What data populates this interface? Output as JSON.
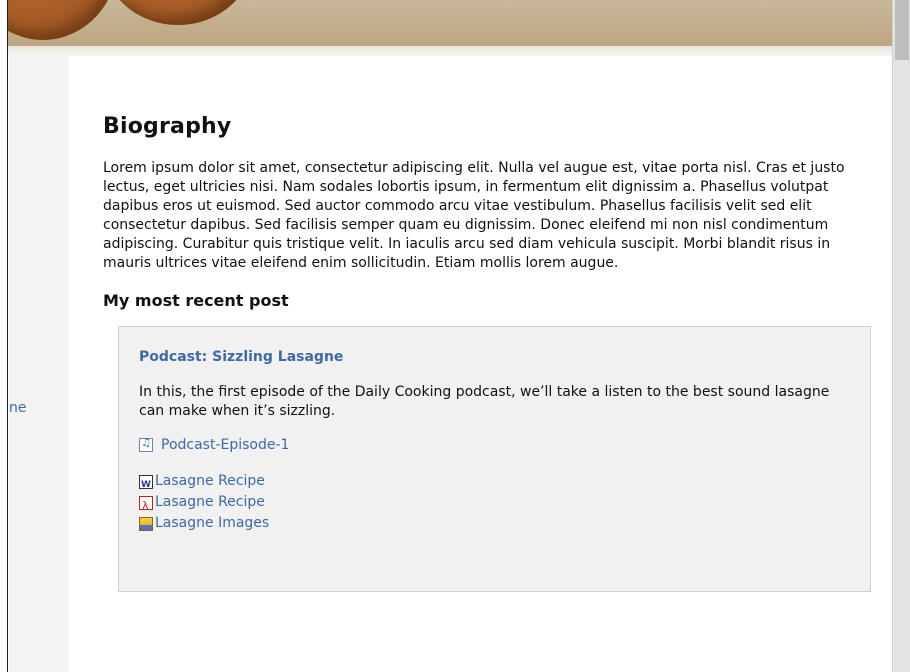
{
  "sidebar": {
    "partial_link": "ne"
  },
  "main": {
    "heading": "Biography",
    "bio": "Lorem ipsum dolor sit amet, consectetur adipiscing elit. Nulla vel augue est, vitae porta nisl. Cras et justo lectus, eget ultricies nisi. Nam sodales lobortis ipsum, in fermentum elit dignissim a. Phasellus volutpat dapibus eros ut euismod. Sed auctor commodo arcu vitae vestibulum. Phasellus facilisis velit sed elit consectetur dapibus. Sed facilisis semper quam eu dignissim. Donec eleifend mi non nisl condimentum adipiscing. Curabitur quis tristique velit. In iaculis arcu sed diam vehicula suscipit. Morbi blandit risus in mauris ultrices vitae eleifend enim sollicitudin. Etiam mollis lorem augue.",
    "recent_heading": "My most recent post"
  },
  "post": {
    "title": "Podcast: Sizzling Lasagne",
    "description": "In this, the first episode of the Daily Cooking podcast, we’ll take a listen to the best sound lasagne can make when it’s sizzling.",
    "media": {
      "label": "Podcast-Episode-1",
      "icon": "audio-file-icon"
    },
    "attachments": [
      {
        "label": "Lasagne Recipe",
        "icon": "word-document-icon"
      },
      {
        "label": "Lasagne Recipe",
        "icon": "pdf-document-icon"
      },
      {
        "label": "Lasagne Images",
        "icon": "image-folder-icon"
      }
    ]
  },
  "colors": {
    "link": "#3d6aa5",
    "banner": "#bda780",
    "post_box_bg": "#f1f1f1",
    "post_box_border": "#cfcfcf"
  }
}
